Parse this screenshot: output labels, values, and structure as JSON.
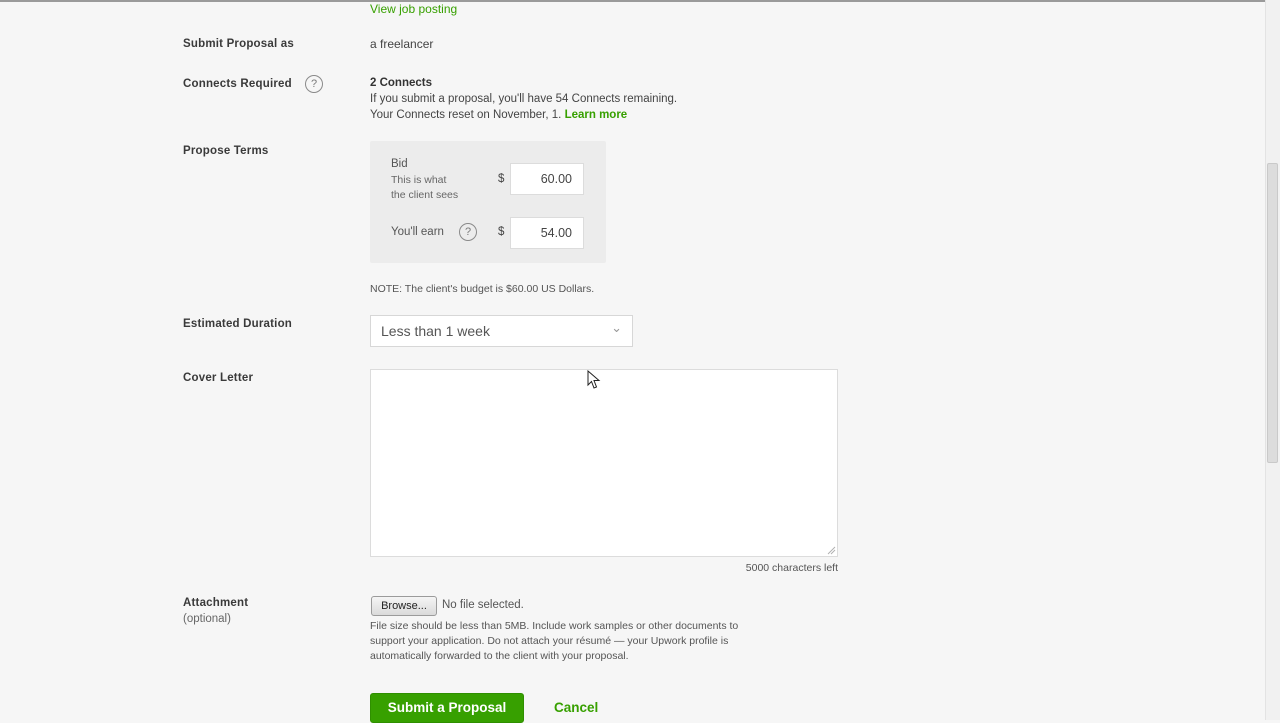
{
  "header": {
    "view_job_posting": "View job posting"
  },
  "submit_as": {
    "label": "Submit Proposal as",
    "value": "a freelancer"
  },
  "connects": {
    "label": "Connects Required",
    "help_icon": "question-circle-icon",
    "help_glyph": "?",
    "count": "2 Connects",
    "line1": "If you submit a proposal, you'll have 54 Connects remaining.",
    "line2_prefix": "Your Connects reset on November, 1.",
    "learn_more": "Learn more"
  },
  "terms": {
    "label": "Propose Terms",
    "bid_label": "Bid",
    "bid_sub1": "This is what",
    "bid_sub2": "the client sees",
    "currency": "$",
    "bid_value": "60.00",
    "earn_label": "You'll earn",
    "earn_help_glyph": "?",
    "earn_value": "54.00",
    "note": "NOTE: The client's budget is $60.00 US Dollars."
  },
  "duration": {
    "label": "Estimated Duration",
    "selected": "Less than 1 week",
    "chevron_icon": "chevron-down-icon",
    "chevron_glyph": "⌄"
  },
  "cover_letter": {
    "label": "Cover Letter",
    "value": "",
    "chars_left": "5000 characters left"
  },
  "attachment": {
    "label": "Attachment",
    "optional": "(optional)",
    "browse": "Browse...",
    "no_file": "No file selected.",
    "help1": "File size should be less than 5MB. Include work samples or other documents to",
    "help2": "support your application. Do not attach your résumé — your Upwork profile is",
    "help3": "automatically forwarded to the client with your proposal."
  },
  "actions": {
    "submit": "Submit a Proposal",
    "cancel": "Cancel"
  },
  "colors": {
    "accent": "#37a000",
    "background": "#f6f6f6"
  }
}
